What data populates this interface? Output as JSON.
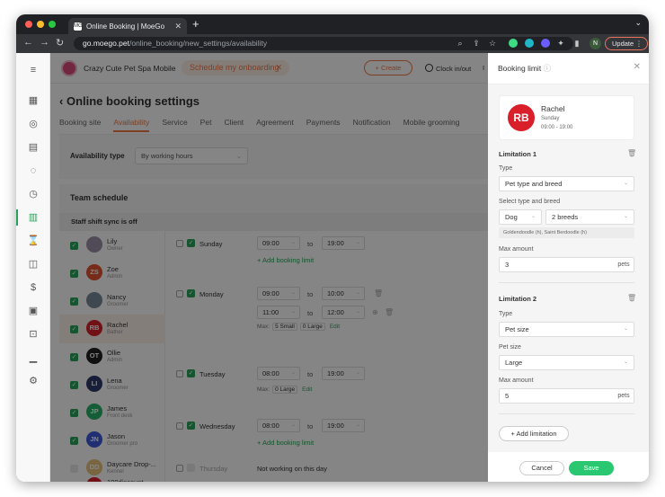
{
  "browser": {
    "tab_title": "Online Booking | MoeGo",
    "tab_favicon": "MG",
    "url_host": "go.moego.pet",
    "url_path": "/online_booking/new_settings/availability",
    "profile_initial": "N",
    "update_label": "Update"
  },
  "topbar": {
    "business_name": "Crazy Cute Pet Spa Mobile",
    "onboarding_label": "Schedule my onboarding",
    "create_label": "+ Create",
    "clock_label": "Clock in/out",
    "clock_label_2": "I"
  },
  "page": {
    "title": "Online booking settings",
    "tabs": [
      {
        "label": "Booking site"
      },
      {
        "label": "Availability"
      },
      {
        "label": "Service"
      },
      {
        "label": "Pet"
      },
      {
        "label": "Client"
      },
      {
        "label": "Agreement"
      },
      {
        "label": "Payments"
      },
      {
        "label": "Notification"
      },
      {
        "label": "Mobile grooming"
      }
    ],
    "active_tab": "Availability",
    "availability_type_label": "Availability type",
    "availability_type_value": "By working hours",
    "team_schedule_title": "Team schedule",
    "staff_sync_text": "Staff shift sync is off"
  },
  "staff": [
    {
      "name": "Lily",
      "role": "Owner",
      "initials": "",
      "color": "#9b8ea8",
      "checked": true
    },
    {
      "name": "Zoe",
      "role": "Admin",
      "initials": "ZS",
      "color": "#e2552f",
      "checked": true
    },
    {
      "name": "Nancy",
      "role": "Groomer",
      "initials": "",
      "color": "#7a8b9a",
      "checked": true
    },
    {
      "name": "Rachel",
      "role": "Bather",
      "initials": "RB",
      "color": "#d91f2a",
      "checked": true
    },
    {
      "name": "Ollie",
      "role": "Admin",
      "initials": "OT",
      "color": "#222222",
      "checked": true
    },
    {
      "name": "Lena",
      "role": "Groomer",
      "initials": "LI",
      "color": "#2f3b6b",
      "checked": true
    },
    {
      "name": "James",
      "role": "Front desk",
      "initials": "JP",
      "color": "#29b36a",
      "checked": true
    },
    {
      "name": "Jason",
      "role": "Groomer pro",
      "initials": "JN",
      "color": "#3f5bd8",
      "checked": true
    },
    {
      "name": "Daycare Drop-...",
      "role": "Kennel",
      "initials": "DD",
      "color": "#e9c27a",
      "checked": false
    },
    {
      "name": "100discount",
      "role": "",
      "initials": "",
      "color": "#d91f2a",
      "checked": true
    }
  ],
  "schedule": {
    "to_label": "to",
    "add_booking_limit": "+ Add booking limit",
    "max_label": "Max:",
    "edit_label": "Edit",
    "days": [
      {
        "day": "Sunday",
        "ranges": [
          {
            "from": "09:00",
            "to": "19:00"
          }
        ],
        "max": [],
        "add_link": true
      },
      {
        "day": "Monday",
        "ranges": [
          {
            "from": "09:00",
            "to": "10:00"
          },
          {
            "from": "11:00",
            "to": "12:00"
          }
        ],
        "max": [
          "5 Small",
          "0 Large"
        ],
        "add_link": false
      },
      {
        "day": "Tuesday",
        "ranges": [
          {
            "from": "08:00",
            "to": "19:00"
          }
        ],
        "max": [
          "0 Large"
        ],
        "add_link": false
      },
      {
        "day": "Wednesday",
        "ranges": [
          {
            "from": "08:00",
            "to": "19:00"
          }
        ],
        "max": [],
        "add_link": true
      },
      {
        "day": "Thursday",
        "ranges": [],
        "not_working": "Not working on this day",
        "max": [],
        "add_link": false
      }
    ]
  },
  "panel": {
    "title": "Booking limit",
    "staff_initials": "RB",
    "staff_name": "Rachel",
    "staff_day": "Sunday",
    "staff_hours": "09:00 - 19:00",
    "limitation1": {
      "title": "Limitation 1",
      "type_label": "Type",
      "type_value": "Pet type and breed",
      "select_label": "Select type and breed",
      "pet_type": "Dog",
      "breeds": "2 breeds",
      "breed_tags": "Goldendoodle (h), Saint Berdoodle (h)",
      "max_label": "Max amount",
      "max_value": "3",
      "unit": "pets"
    },
    "limitation2": {
      "title": "Limitation 2",
      "type_label": "Type",
      "type_value": "Pet size",
      "size_label": "Pet size",
      "size_value": "Large",
      "max_label": "Max amount",
      "max_value": "5",
      "unit": "pets"
    },
    "add_limitation": "+ Add limitation",
    "cancel_label": "Cancel",
    "save_label": "Save"
  },
  "colors": {
    "accent": "#ef7a4a",
    "green": "#29a35a",
    "save": "#29c76f"
  }
}
